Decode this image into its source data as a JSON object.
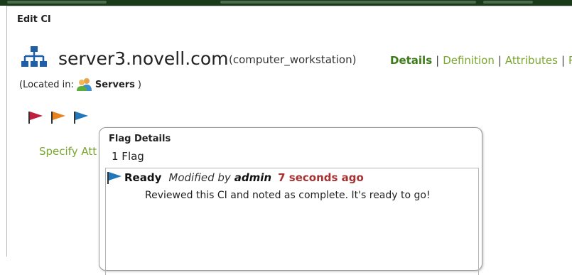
{
  "dialog": {
    "title": "Edit CI"
  },
  "ci": {
    "name": "server3.novell.com",
    "type": "(computer_workstation)",
    "located_prefix": "(Located in:",
    "located_name": "Servers",
    "located_suffix": ")",
    "icon": "network-topology-icon"
  },
  "nav": {
    "items": [
      {
        "label": "Details",
        "active": true
      },
      {
        "label": "Definition",
        "active": false
      },
      {
        "label": "Attributes",
        "active": false
      },
      {
        "label": "R",
        "active": false
      }
    ],
    "separator": "|"
  },
  "flags": [
    {
      "color": "#c21d3c",
      "icon": "red-flag-icon"
    },
    {
      "color": "#e8821e",
      "icon": "orange-flag-icon"
    },
    {
      "color": "#2377b8",
      "icon": "blue-flag-icon"
    }
  ],
  "specify_label": "Specify Att",
  "flag_details": {
    "title": "Flag Details",
    "count": "1 Flag",
    "entries": [
      {
        "status": "Ready",
        "modified_by_label": "Modified by",
        "user": "admin",
        "time": "7 seconds ago",
        "comment": "Reviewed this CI and noted as complete. It's ready to go!",
        "flag_color": "#2377b8",
        "icon": "blue-flag-icon"
      }
    ]
  },
  "colors": {
    "accent": "#7aa62e",
    "accent_active": "#3d7a1a",
    "time": "#a63232"
  }
}
